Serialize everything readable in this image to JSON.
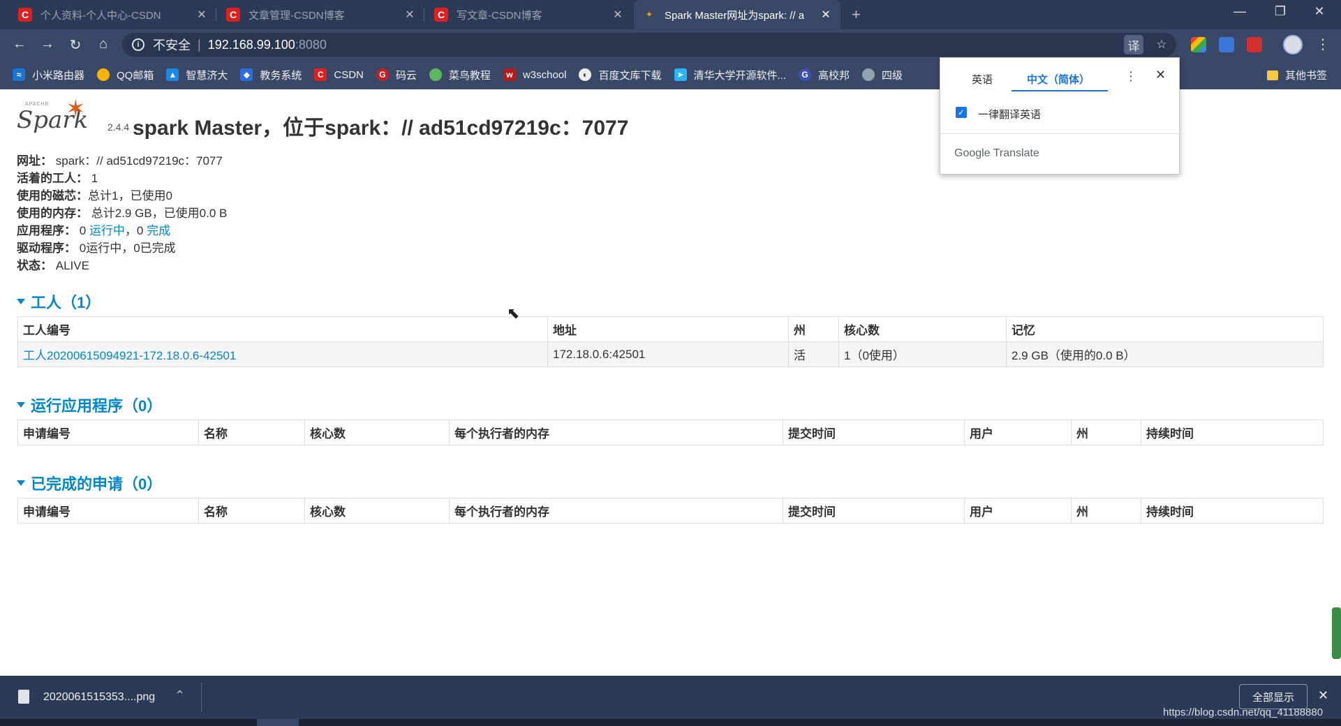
{
  "browser": {
    "tabs": [
      {
        "title": "个人资料-个人中心-CSDN",
        "favicon": "C"
      },
      {
        "title": "文章管理-CSDN博客",
        "favicon": "C"
      },
      {
        "title": "写文章-CSDN博客",
        "favicon": "C"
      },
      {
        "title": "Spark Master网址为spark: // a",
        "favicon": "spark"
      }
    ],
    "new_tab": "+",
    "window_controls": {
      "minimize": "—",
      "restore": "❐",
      "close": "✕"
    },
    "address": {
      "security": "不安全",
      "separator": "|",
      "host": "192.168.99.100",
      "port": ":8080"
    },
    "bookmarks": [
      {
        "label": "小米路由器",
        "icon_color": "#1976d2"
      },
      {
        "label": "QQ邮箱",
        "icon_color": "#f4b400"
      },
      {
        "label": "智慧济大",
        "icon_color": "#1e88e5"
      },
      {
        "label": "教务系统",
        "icon_color": "#2d6cdf"
      },
      {
        "label": "CSDN",
        "icon_color": "#e0201e"
      },
      {
        "label": "码云",
        "icon_color": "#c71d23"
      },
      {
        "label": "菜鸟教程",
        "icon_color": "#5cb85c"
      },
      {
        "label": "w3school",
        "icon_color": "#b71c1c"
      },
      {
        "label": "百度文库下载",
        "icon_color": "#eeeeee"
      },
      {
        "label": "清华大学开源软件...",
        "icon_color": "#29b6f6"
      },
      {
        "label": "高校邦",
        "icon_color": "#3f51b5"
      },
      {
        "label": "四级",
        "icon_color": "#90a4ae"
      }
    ],
    "other_bookmarks": "其他书签"
  },
  "translate_popup": {
    "source_lang": "英语",
    "target_lang": "中文（简体）",
    "always_translate": "一律翻译英语",
    "brand": "Google Translate"
  },
  "page": {
    "logo_text": "Spark",
    "logo_apache": "APACHE",
    "version": "2.4.4",
    "title": "spark Master，位于spark：// ad51cd97219c：7077",
    "summary": {
      "url_label": "网址：",
      "url_value": "spark：// ad51cd97219c：7077",
      "alive_workers_label": "活着的工人：",
      "alive_workers_value": "1",
      "cores_label": "使用的磁芯：",
      "cores_value": "总计1，已使用0",
      "memory_label": "使用的内存：",
      "memory_value": "总计2.9 GB，已使用0.0 B",
      "apps_label": "应用程序：",
      "apps_running_count": "0",
      "apps_running_link": "运行中",
      "apps_sep": "，0",
      "apps_completed_link": "完成",
      "drivers_label": "驱动程序：",
      "drivers_value": "0运行中，0已完成",
      "status_label": "状态：",
      "status_value": "ALIVE"
    },
    "workers": {
      "heading": "工人（1）",
      "columns": [
        "工人编号",
        "地址",
        "州",
        "核心数",
        "记忆"
      ],
      "rows": [
        [
          "工人20200615094921-172.18.0.6-42501",
          "172.18.0.6:42501",
          "活",
          "1（0使用）",
          "2.9 GB（使用的0.0 B）"
        ]
      ]
    },
    "running_apps": {
      "heading": "运行应用程序（0）",
      "columns": [
        "申请编号",
        "名称",
        "核心数",
        "每个执行者的内存",
        "提交时间",
        "用户",
        "州",
        "持续时间"
      ]
    },
    "completed_apps": {
      "heading": "已完成的申请（0）",
      "columns": [
        "申请编号",
        "名称",
        "核心数",
        "每个执行者的内存",
        "提交时间",
        "用户",
        "州",
        "持续时间"
      ]
    }
  },
  "download_bar": {
    "file_name": "2020061515353....png",
    "show_all": "全部显示"
  },
  "watermark": "https://blog.csdn.net/qq_41188880"
}
